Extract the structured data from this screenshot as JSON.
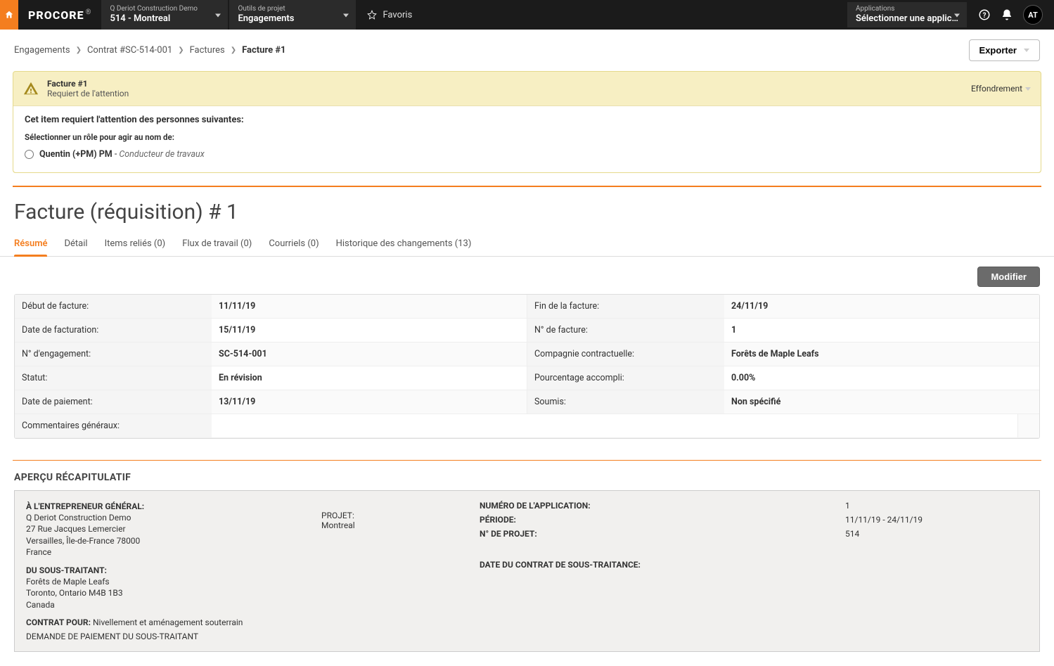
{
  "topbar": {
    "project_label": "Q Deriot Construction Demo",
    "project_value": "514 - Montreal",
    "tool_label": "Outils de projet",
    "tool_value": "Engagements",
    "favorites": "Favoris",
    "apps_label": "Applications",
    "apps_value": "Sélectionner une applicati...",
    "avatar": "AT"
  },
  "breadcrumbs": {
    "i0": "Engagements",
    "i1": "Contrat #SC-514-001",
    "i2": "Factures",
    "i3": "Facture #1",
    "export": "Exporter"
  },
  "banner": {
    "title": "Facture #1",
    "subtitle": "Requiert de l'attention",
    "collapse": "Effondrement",
    "attention_heading": "Cet item requiert l'attention des personnes suivantes:",
    "role_select_label": "Sélectionner un rôle pour agir au nom de:",
    "role_name": "Quentin (+PM) PM",
    "role_sep": " - ",
    "role_desc": "Conducteur de travaux"
  },
  "page": {
    "title": "Facture (réquisition) # 1",
    "modify": "Modifier"
  },
  "tabs": {
    "t0": "Résumé",
    "t1": "Détail",
    "t2": "Items reliés (0)",
    "t3": "Flux de travail (0)",
    "t4": "Courriels (0)",
    "t5": "Historique des changements (13)"
  },
  "summary": {
    "l_start": "Début de facture:",
    "v_start": "11/11/19",
    "l_end": "Fin de la facture:",
    "v_end": "24/11/19",
    "l_billdate": "Date de facturation:",
    "v_billdate": "15/11/19",
    "l_invno": "N° de facture:",
    "v_invno": "1",
    "l_commit": "N° d'engagement:",
    "v_commit": "SC-514-001",
    "l_company": "Compagnie contractuelle:",
    "v_company": "Forêts de Maple Leafs",
    "l_status": "Statut:",
    "v_status": "En révision",
    "l_pct": "Pourcentage accompli:",
    "v_pct": "0.00%",
    "l_paydate": "Date de paiement:",
    "v_paydate": "13/11/19",
    "l_submitted": "Soumis:",
    "v_submitted": "Non spécifié",
    "l_comments": "Commentaires généraux:",
    "v_comments": ""
  },
  "recap": {
    "heading": "APERÇU RÉCAPITULATIF",
    "gc_label": "À L'ENTREPRENEUR GÉNÉRAL:",
    "gc_l1": "Q Deriot Construction Demo",
    "gc_l2": "27 Rue Jacques Lemercier",
    "gc_l3": "Versailles, Île-de-France 78000",
    "gc_l4": "France",
    "sub_label": "DU SOUS-TRAITANT:",
    "sub_l1": "Forêts de Maple Leafs",
    "sub_l2": "Toronto, Ontario M4B 1B3",
    "sub_l3": "Canada",
    "contract_for_label": "CONTRAT POUR:",
    "contract_for_value": "Nivellement et aménagement souterrain",
    "payreq_label": "DEMANDE DE PAIEMENT DU SOUS-TRAITANT",
    "project_label": "PROJET:",
    "project_value": "Montreal",
    "appno_label": "NUMÉRO DE L'APPLICATION:",
    "appno_value": "1",
    "period_label": "PÉRIODE:",
    "period_value": "11/11/19 - 24/11/19",
    "projno_label": "N° DE PROJET:",
    "projno_value": "514",
    "subcontract_date_label": "DATE DU CONTRAT DE SOUS-TRAITANCE:"
  }
}
